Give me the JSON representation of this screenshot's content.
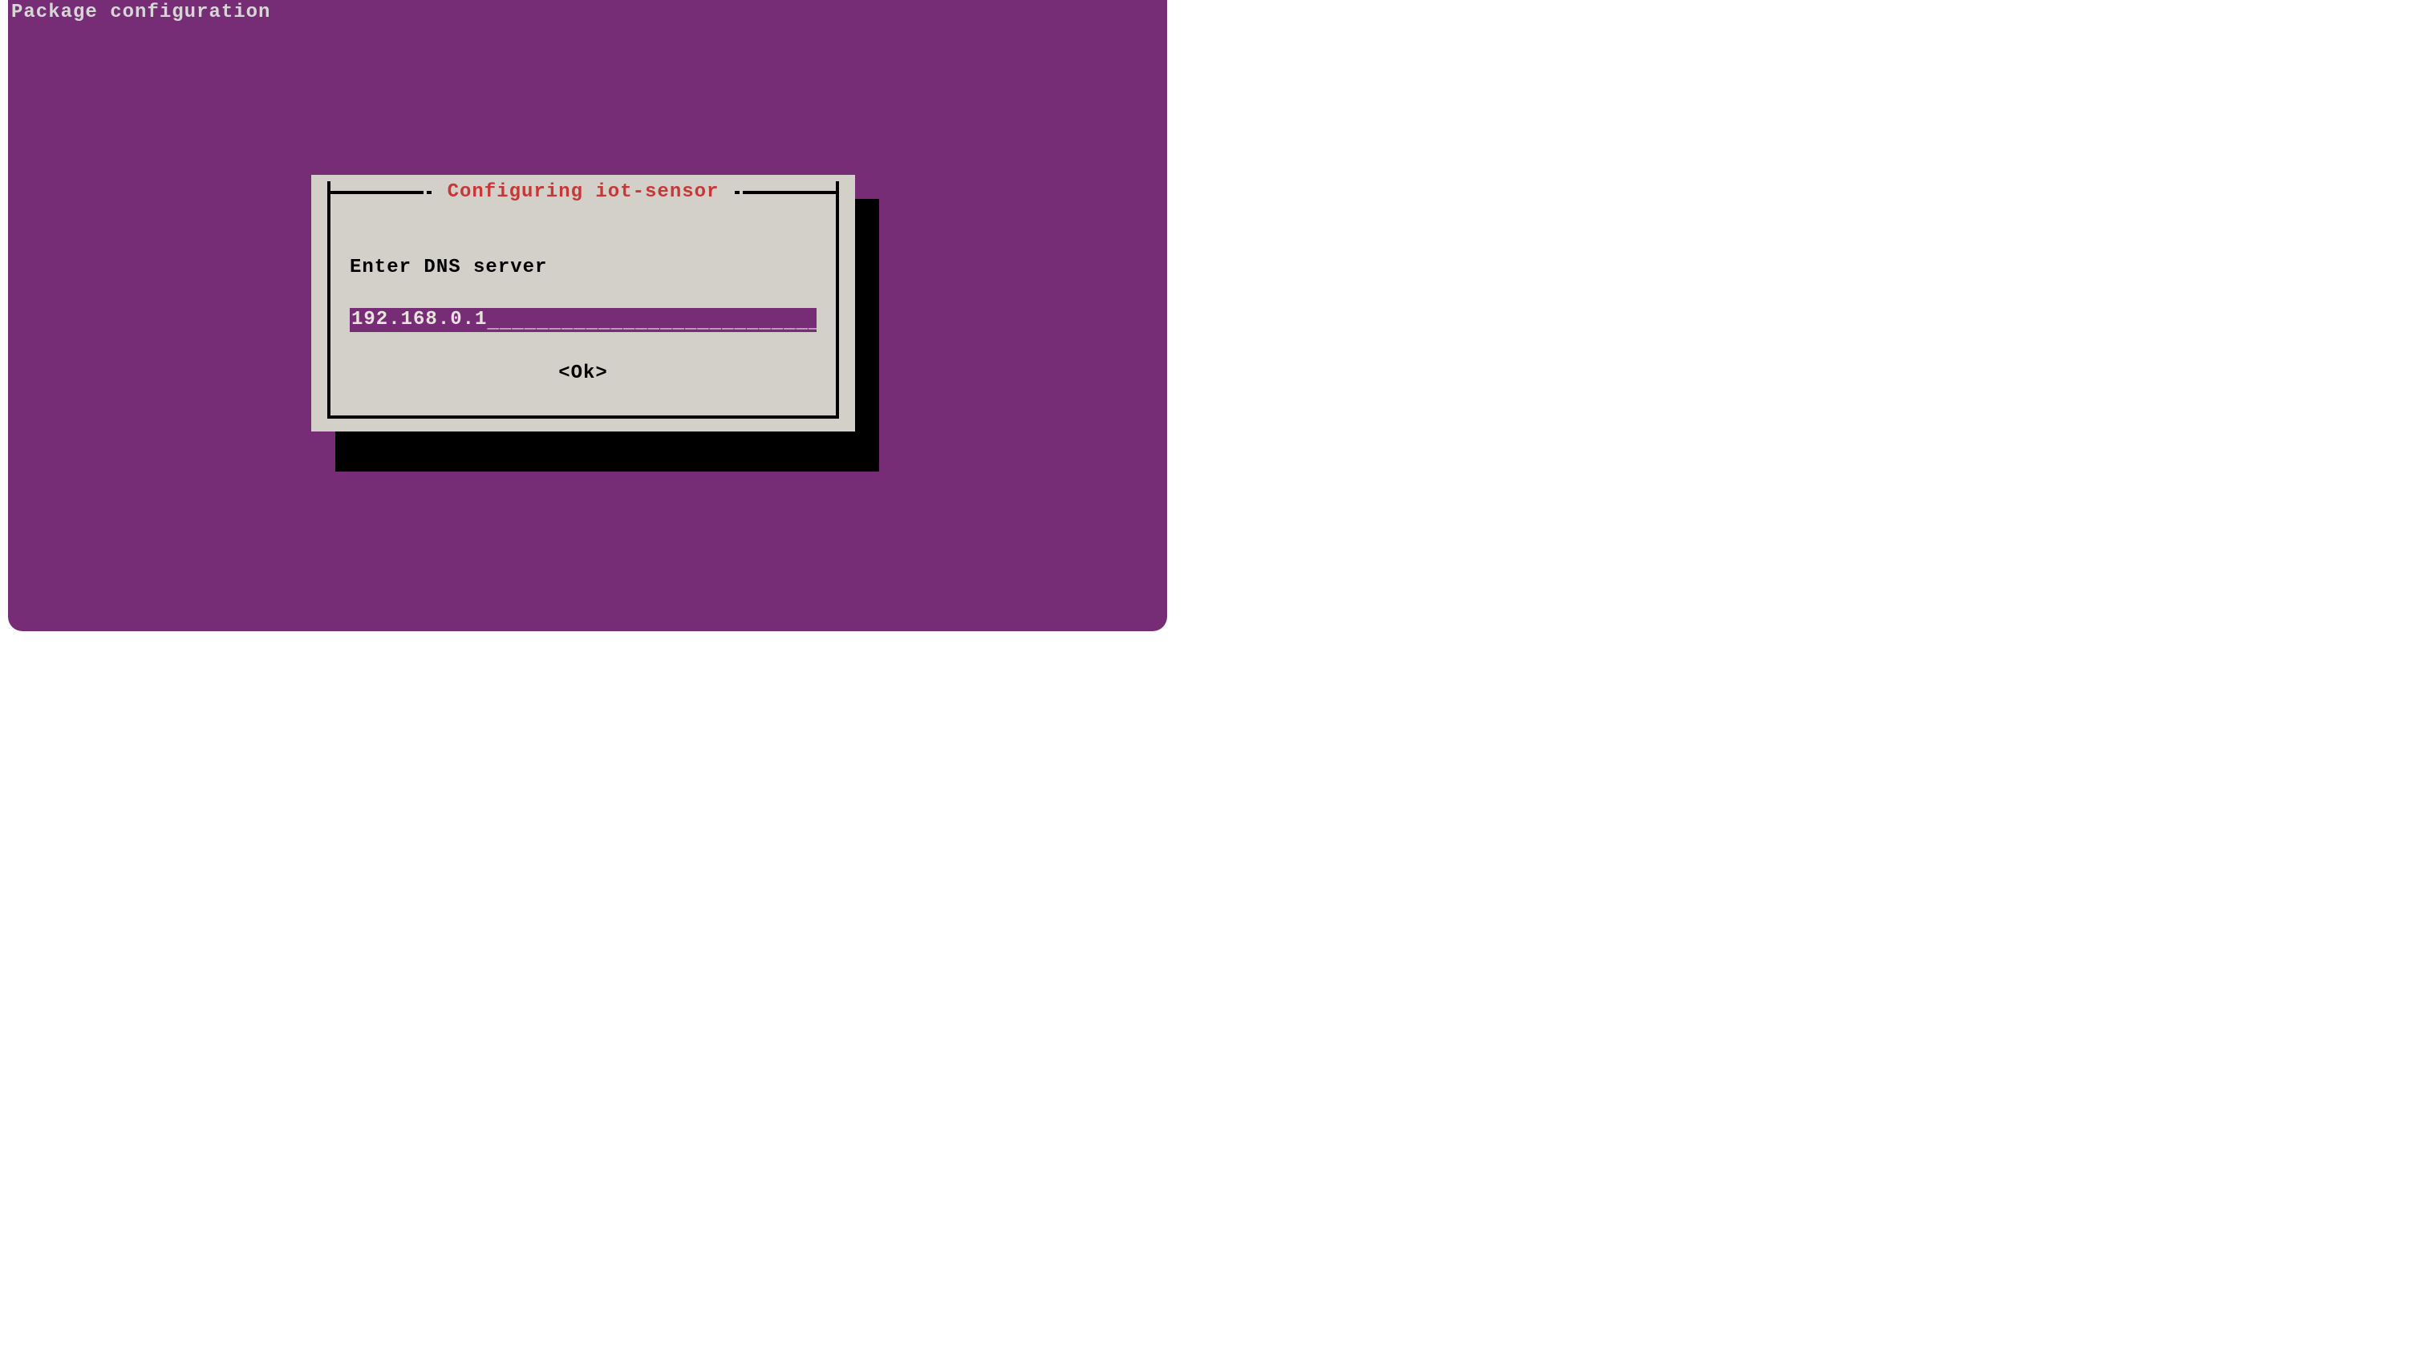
{
  "header": {
    "title": "Package configuration"
  },
  "dialog": {
    "title": "Configuring iot-sensor",
    "prompt": "Enter DNS server",
    "input_value": "192.168.0.1",
    "ok_label": "<Ok>"
  },
  "colors": {
    "background": "#772d76",
    "dialog_bg": "#d3d0c9",
    "title_fg": "#c83737",
    "text_light": "#d6d6d6",
    "shadow": "#000000"
  }
}
